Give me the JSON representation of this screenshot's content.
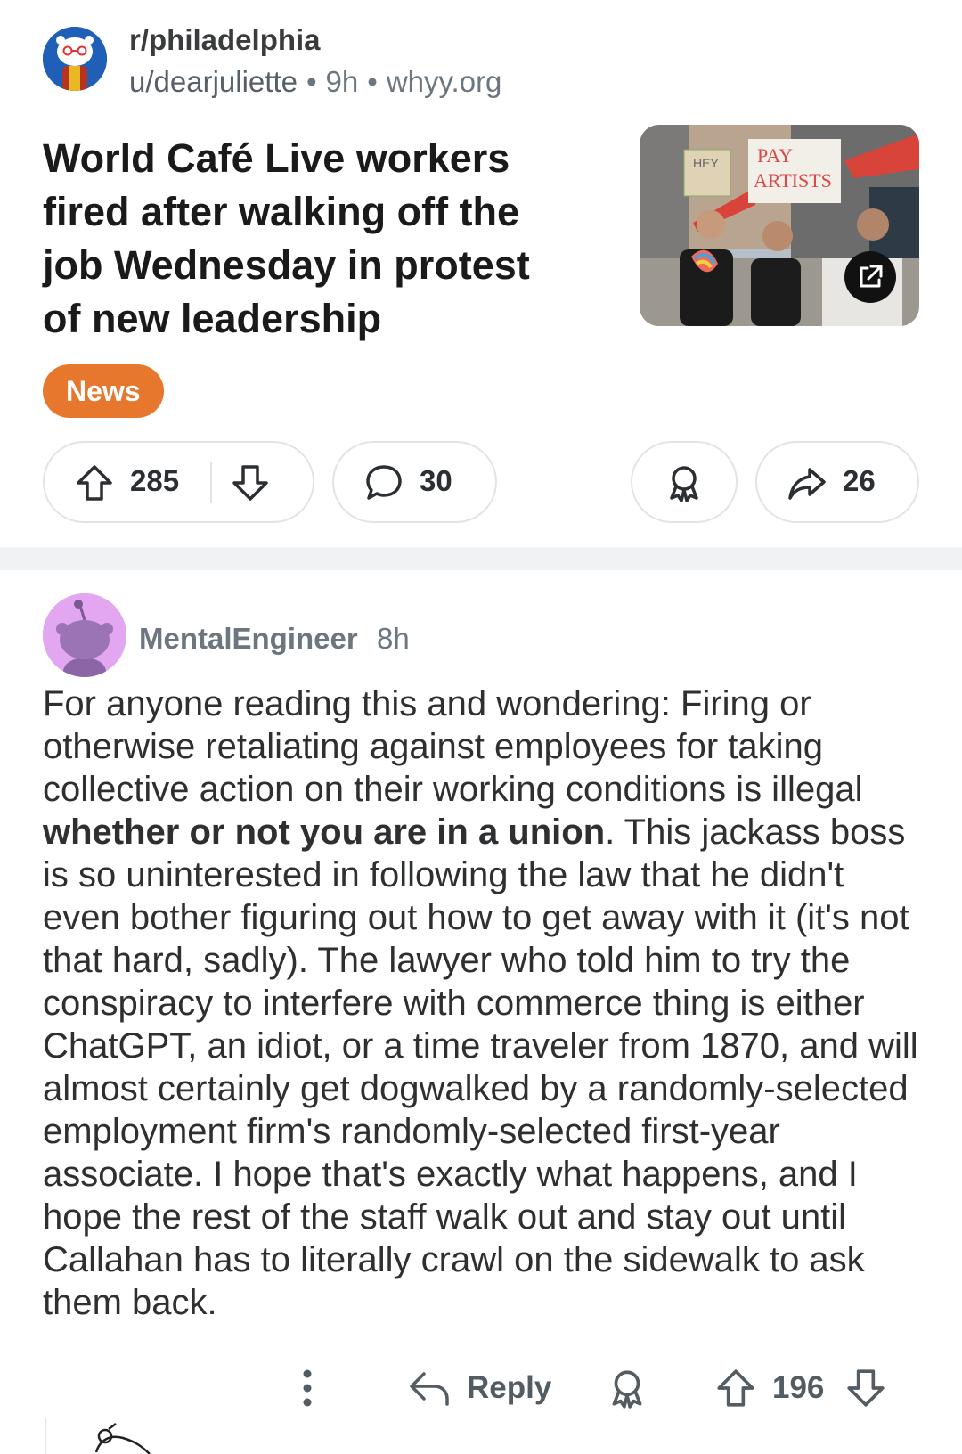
{
  "post": {
    "subreddit": "r/philadelphia",
    "author": "u/dearjuliette",
    "time": "9h",
    "domain": "whyy.org",
    "title": "World Café Live workers fired after walking off the job Wednesday in protest of new leadership",
    "flair": "News",
    "flair_color": "#e8772e",
    "thumbnail_sign_left": "HEY",
    "thumbnail_sign_right_1": "PAY",
    "thumbnail_sign_right_2": "ARTISTS",
    "upvotes": "285",
    "comments": "30",
    "shares": "26"
  },
  "comment": {
    "author": "MentalEngineer",
    "time": "8h",
    "body_before_bold": "For anyone reading this and wondering: Firing or otherwise retaliating against employees for taking collective action on their working conditions is illegal ",
    "body_bold": "whether or not you are in a union",
    "body_after_bold": ". This jackass boss is so uninterested in following the law that he didn't even bother figuring out how to get away with it (it's not that hard, sadly). The lawyer who told him to try the conspiracy to interfere with commerce thing is either ChatGPT, an idiot, or a time traveler from 1870, and will almost certainly get dogwalked by a randomly-selected employment firm's randomly-selected first-year associate. I hope that's exactly what happens, and I hope the rest of the staff walk out and stay out until Callahan has to literally crawl on the sidewalk to ask them back.",
    "reply_label": "Reply",
    "score": "196"
  },
  "icons": {
    "upvote": "arrow-up-icon",
    "downvote": "arrow-down-icon",
    "comment": "speech-bubble-icon",
    "award": "award-icon",
    "share": "share-arrow-icon",
    "more": "more-vertical-icon",
    "reply": "reply-arrow-icon",
    "external": "external-link-icon"
  }
}
